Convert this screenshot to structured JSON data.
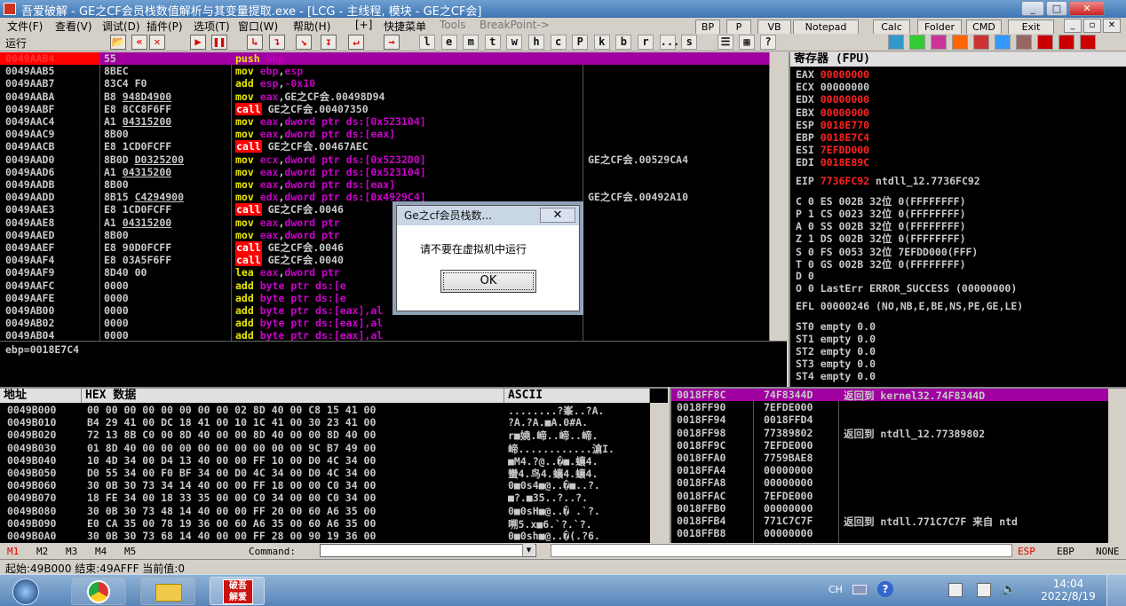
{
  "title": "吾爱破解 - GE之CF会员栈数值解析与其变量提取.exe - [LCG - 主线程, 模块 - GE之CF会]",
  "window_buttons": [
    "_",
    "□",
    "✕"
  ],
  "menu": [
    "文件(F)",
    "查看(V)",
    "调试(D)",
    "插件(P)",
    "选项(T)",
    "窗口(W)",
    "帮助(H)",
    "[+]",
    "快捷菜单",
    "Tools",
    "BreakPoint->"
  ],
  "quick": [
    "BP",
    "P",
    "VB",
    "Notepad",
    "Calc",
    "Folder",
    "CMD",
    "Exit"
  ],
  "mdi_buttons": [
    "_",
    "▫",
    "✕"
  ],
  "toolbar": {
    "status": "运行",
    "letters": [
      "l",
      "e",
      "m",
      "t",
      "w",
      "h",
      "c",
      "P",
      "k",
      "b",
      "r",
      "...",
      "s"
    ]
  },
  "disasm": [
    {
      "addr": "0049AAB4",
      "hex": "55",
      "asm": [
        [
          "mnem",
          "push "
        ],
        [
          "reg",
          "ebp"
        ]
      ],
      "sel": true
    },
    {
      "addr": "0049AAB5",
      "hex": "8BEC",
      "asm": [
        [
          "mnem",
          "mov "
        ],
        [
          "reg",
          "ebp"
        ],
        [
          "txt",
          ","
        ],
        [
          "reg",
          "esp"
        ]
      ]
    },
    {
      "addr": "0049AAB7",
      "hex": "83C4 F0",
      "asm": [
        [
          "mnem",
          "add "
        ],
        [
          "reg",
          "esp"
        ],
        [
          "txt",
          ","
        ],
        [
          "reg",
          "-0x10"
        ]
      ]
    },
    {
      "addr": "0049AABA",
      "hex": "B8 948D4900",
      "ul": "948D4900",
      "asm": [
        [
          "mnem",
          "mov "
        ],
        [
          "reg",
          "eax"
        ],
        [
          "txt",
          ",GE之CF会.00498D94"
        ]
      ]
    },
    {
      "addr": "0049AABF",
      "hex": "E8 8CC8F6FF",
      "asm": [
        [
          "call",
          "call"
        ],
        [
          "txt",
          " GE之CF会.00407350"
        ]
      ]
    },
    {
      "addr": "0049AAC4",
      "hex": "A1 04315200",
      "ul": "04315200",
      "asm": [
        [
          "mnem",
          "mov "
        ],
        [
          "reg",
          "eax"
        ],
        [
          "txt",
          ","
        ],
        [
          "mem",
          "dword ptr ds:[0x523104]"
        ]
      ]
    },
    {
      "addr": "0049AAC9",
      "hex": "8B00",
      "asm": [
        [
          "mnem",
          "mov "
        ],
        [
          "reg",
          "eax"
        ],
        [
          "txt",
          ","
        ],
        [
          "mem",
          "dword ptr ds:[eax]"
        ]
      ]
    },
    {
      "addr": "0049AACB",
      "hex": "E8 1CD0FCFF",
      "asm": [
        [
          "call",
          "call"
        ],
        [
          "txt",
          " GE之CF会.00467AEC"
        ]
      ]
    },
    {
      "addr": "0049AAD0",
      "hex": "8B0D D0325200",
      "ul": "D0325200",
      "asm": [
        [
          "mnem",
          "mov "
        ],
        [
          "reg",
          "ecx"
        ],
        [
          "txt",
          ","
        ],
        [
          "mem",
          "dword ptr ds:[0x5232D0]"
        ]
      ],
      "cmt": "GE之CF会.00529CA4"
    },
    {
      "addr": "0049AAD6",
      "hex": "A1 04315200",
      "ul": "04315200",
      "asm": [
        [
          "mnem",
          "mov "
        ],
        [
          "reg",
          "eax"
        ],
        [
          "txt",
          ","
        ],
        [
          "mem",
          "dword ptr ds:[0x523104]"
        ]
      ]
    },
    {
      "addr": "0049AADB",
      "hex": "8B00",
      "asm": [
        [
          "mnem",
          "mov "
        ],
        [
          "reg",
          "eax"
        ],
        [
          "txt",
          ","
        ],
        [
          "mem",
          "dword ptr ds:[eax]"
        ]
      ]
    },
    {
      "addr": "0049AADD",
      "hex": "8B15 C4294900",
      "ul": "C4294900",
      "asm": [
        [
          "mnem",
          "mov "
        ],
        [
          "reg",
          "edx"
        ],
        [
          "txt",
          ","
        ],
        [
          "mem",
          "dword ptr ds:[0x4929C4]"
        ]
      ],
      "cmt": "GE之CF会.00492A10"
    },
    {
      "addr": "0049AAE3",
      "hex": "E8 1CD0FCFF",
      "asm": [
        [
          "call",
          "call"
        ],
        [
          "txt",
          " GE之CF会.0046"
        ]
      ]
    },
    {
      "addr": "0049AAE8",
      "hex": "A1 04315200",
      "ul": "04315200",
      "asm": [
        [
          "mnem",
          "mov "
        ],
        [
          "reg",
          "eax"
        ],
        [
          "txt",
          ","
        ],
        [
          "mem",
          "dword ptr"
        ]
      ]
    },
    {
      "addr": "0049AAED",
      "hex": "8B00",
      "asm": [
        [
          "mnem",
          "mov "
        ],
        [
          "reg",
          "eax"
        ],
        [
          "txt",
          ","
        ],
        [
          "mem",
          "dword ptr"
        ]
      ]
    },
    {
      "addr": "0049AAEF",
      "hex": "E8 90D0FCFF",
      "asm": [
        [
          "call",
          "call"
        ],
        [
          "txt",
          " GE之CF会.0046"
        ]
      ]
    },
    {
      "addr": "0049AAF4",
      "hex": "E8 03A5F6FF",
      "asm": [
        [
          "call",
          "call"
        ],
        [
          "txt",
          " GE之CF会.0040"
        ]
      ]
    },
    {
      "addr": "0049AAF9",
      "hex": "8D40 00",
      "asm": [
        [
          "mnem",
          "lea "
        ],
        [
          "reg",
          "eax"
        ],
        [
          "txt",
          ","
        ],
        [
          "mem",
          "dword ptr"
        ]
      ]
    },
    {
      "addr": "0049AAFC",
      "hex": "0000",
      "asm": [
        [
          "mnem",
          "add "
        ],
        [
          "mem",
          "byte ptr ds:[e"
        ]
      ]
    },
    {
      "addr": "0049AAFE",
      "hex": "0000",
      "asm": [
        [
          "mnem",
          "add "
        ],
        [
          "mem",
          "byte ptr ds:[e"
        ]
      ]
    },
    {
      "addr": "0049AB00",
      "hex": "0000",
      "asm": [
        [
          "mnem",
          "add "
        ],
        [
          "mem",
          "byte ptr ds:[eax],al"
        ]
      ]
    },
    {
      "addr": "0049AB02",
      "hex": "0000",
      "asm": [
        [
          "mnem",
          "add "
        ],
        [
          "mem",
          "byte ptr ds:[eax],al"
        ]
      ]
    },
    {
      "addr": "0049AB04",
      "hex": "0000",
      "asm": [
        [
          "mnem",
          "add "
        ],
        [
          "mem",
          "byte ptr ds:[eax],al"
        ]
      ]
    }
  ],
  "info_line": "ebp=0018E7C4",
  "registers": {
    "header": "寄存器 (FPU)",
    "rows": [
      {
        "n": "EAX",
        "v": "00000000",
        "red": true
      },
      {
        "n": "ECX",
        "v": "00000000"
      },
      {
        "n": "EDX",
        "v": "00000000",
        "red": true
      },
      {
        "n": "EBX",
        "v": "00000000",
        "red": true
      },
      {
        "n": "ESP",
        "v": "0018E770",
        "red": true
      },
      {
        "n": "EBP",
        "v": "0018E7C4",
        "red": true
      },
      {
        "n": "ESI",
        "v": "7EFDD000",
        "red": true
      },
      {
        "n": "EDI",
        "v": "0018E89C",
        "red": true
      }
    ],
    "eip": {
      "n": "EIP",
      "v": "7736FC92",
      "rest": " ntdll_12.7736FC92"
    },
    "flags": [
      "C 0  ES 002B 32位 0(FFFFFFFF)",
      "P 1  CS 0023 32位 0(FFFFFFFF)",
      "A 0  SS 002B 32位 0(FFFFFFFF)",
      "Z 1  DS 002B 32位 0(FFFFFFFF)",
      "S 0  FS 0053 32位 7EFDD000(FFF)",
      "T 0  GS 002B 32位 0(FFFFFFFF)",
      "D 0",
      "O 0  LastErr ERROR_SUCCESS (00000000)"
    ],
    "efl": "EFL 00000246 (NO,NB,E,BE,NS,PE,GE,LE)",
    "fpu": [
      "ST0 empty 0.0",
      "ST1 empty 0.0",
      "ST2 empty 0.0",
      "ST3 empty 0.0",
      "ST4 empty 0.0"
    ]
  },
  "dump": {
    "h_addr": "地址",
    "h_hex": "HEX 数据",
    "h_ascii": "ASCII",
    "rows": [
      {
        "a": "0049B000",
        "h": "00 00 00 00 00 00 00 00 02 8D 40 00 C8 15 41 00",
        "s": "........?峯..?A."
      },
      {
        "a": "0049B010",
        "h": "B4 29 41 00 DC 18 41 00 10 1C 41 00 30 23 41 00",
        "s": "?A.?A.■A.0#A."
      },
      {
        "a": "0049B020",
        "h": "72 13 8B C0 00 8D 40 00 00 8D 40 00 00 8D 40 00",
        "s": "r■嬈.崹..崹..崹."
      },
      {
        "a": "0049B030",
        "h": "01 8D 40 00 00 00 00 00 00 00 00 00 9C B7 49 00",
        "s": "崹............滄I."
      },
      {
        "a": "0049B040",
        "h": "10 4D 34 00 D4 13 40 00 00 FF 10 00 D0 4C 34 00",
        "s": "■M4.?@..�■.蠰4."
      },
      {
        "a": "0049B050",
        "h": "D0 55 34 00 F0 BF 34 00 D0 4C 34 00 D0 4C 34 00",
        "s": "蠻4.鸟4.蠰4.蠰4."
      },
      {
        "a": "0049B060",
        "h": "30 0B 30 73 34 14 40 00 00 FF 18 00 00 C0 34 00",
        "s": "0■0s4■@..�■..?."
      },
      {
        "a": "0049B070",
        "h": "18 FE 34 00 18 33 35 00 00 C0 34 00 00 C0 34 00",
        "s": "■?.■35..?..?."
      },
      {
        "a": "0049B080",
        "h": "30 0B 30 73 48 14 40 00 00 FF 20 00 60 A6 35 00",
        "s": "0■0sH■@..� .`?."
      },
      {
        "a": "0049B090",
        "h": "E0 CA 35 00 78 19 36 00 60 A6 35 00 60 A6 35 00",
        "s": "嗍5.x■6.`?.`?."
      },
      {
        "a": "0049B0A0",
        "h": "30 0B 30 73 68 14 40 00 00 FF 28 00 90 19 36 00",
        "s": "0■0sh■@..�(.?6."
      }
    ]
  },
  "stack": [
    {
      "a": "0018FF8C",
      "v": "74F8344D",
      "c": "返回到 kernel32.74F8344D",
      "sel": true
    },
    {
      "a": "0018FF90",
      "v": "7EFDE000",
      "c": ""
    },
    {
      "a": "0018FF94",
      "v": "0018FFD4",
      "c": ""
    },
    {
      "a": "0018FF98",
      "v": "77389802",
      "c": "返回到 ntdll_12.77389802"
    },
    {
      "a": "0018FF9C",
      "v": "7EFDE000",
      "c": ""
    },
    {
      "a": "0018FFA0",
      "v": "7759BAE8",
      "c": ""
    },
    {
      "a": "0018FFA4",
      "v": "00000000",
      "c": ""
    },
    {
      "a": "0018FFA8",
      "v": "00000000",
      "c": ""
    },
    {
      "a": "0018FFAC",
      "v": "7EFDE000",
      "c": ""
    },
    {
      "a": "0018FFB0",
      "v": "00000000",
      "c": ""
    },
    {
      "a": "0018FFB4",
      "v": "771C7C7F",
      "c": "返回到 ntdll.771C7C7F 来自 ntd"
    },
    {
      "a": "0018FFB8",
      "v": "00000000",
      "c": ""
    }
  ],
  "cmdbar": {
    "m": [
      "M1",
      "M2",
      "M3",
      "M4",
      "M5"
    ],
    "label": "Command:",
    "regs": [
      "ESP",
      "EBP",
      "NONE"
    ]
  },
  "status": "起始:49B000 结束:49AFFF 当前值:0",
  "dialog": {
    "title": "Ge之cf会员栈数...",
    "close": "✕",
    "message": "请不要在虚拟机中运行",
    "ok": "OK"
  },
  "taskbar": {
    "app_label1": "破吾",
    "app_label2": "解爱",
    "lang": "CH",
    "time": "14:04",
    "date": "2022/8/19"
  },
  "colors": {
    "purple": "#a000a0",
    "red": "#ff0000",
    "yellow": "#e8e800",
    "magenta": "#d000d0"
  }
}
